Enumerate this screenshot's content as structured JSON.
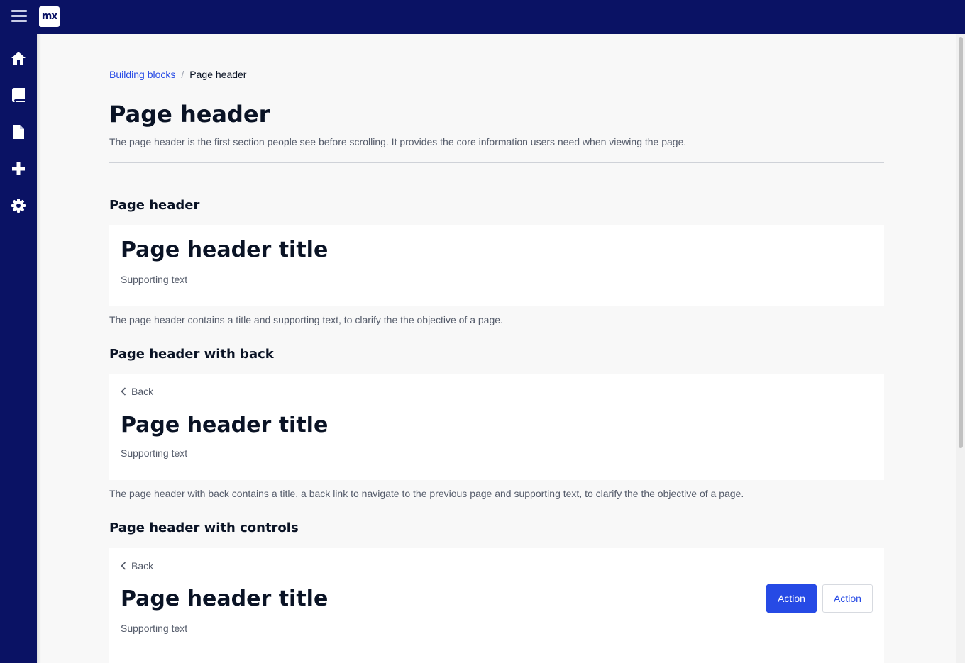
{
  "app": {
    "logo_text": "mx",
    "accent": "#264ae5",
    "nav_bg": "#0a1264"
  },
  "topbar": {
    "menu_icon": "hamburger-menu-icon"
  },
  "sidebar": {
    "items": [
      {
        "icon": "home-icon"
      },
      {
        "icon": "book-icon"
      },
      {
        "icon": "file-icon"
      },
      {
        "icon": "plus-icon"
      },
      {
        "icon": "gear-icon"
      }
    ]
  },
  "breadcrumb": {
    "parent": "Building blocks",
    "separator": "/",
    "current": "Page header"
  },
  "header": {
    "title": "Page header",
    "subtitle": "The page header is the first section people see before scrolling. It provides the core information users need when viewing the page."
  },
  "sections": [
    {
      "title": "Page header",
      "example": {
        "title": "Page header title",
        "supporting": "Supporting text"
      },
      "description": "The page header contains a title and supporting text, to clarify the the objective of a page."
    },
    {
      "title": "Page header with back",
      "example": {
        "back": "Back",
        "title": "Page header title",
        "supporting": "Supporting text"
      },
      "description": "The page header with back contains a title, a back link to navigate to the previous page and supporting text, to clarify the the objective of a page."
    },
    {
      "title": "Page header with controls",
      "example": {
        "back": "Back",
        "title": "Page header title",
        "supporting": "Supporting text",
        "primary_action": "Action",
        "secondary_action": "Action"
      }
    }
  ]
}
